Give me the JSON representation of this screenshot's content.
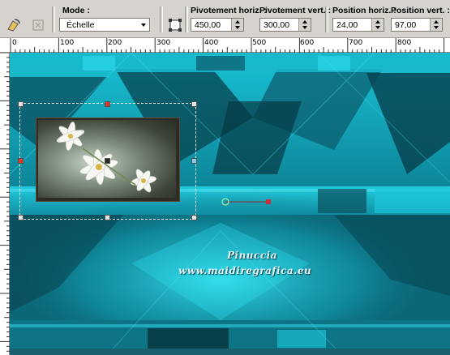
{
  "toolbar": {
    "mode_label": "Mode :",
    "mode_value": "Échelle",
    "pivot_h_label": "Pivotement horiz. :",
    "pivot_h_value": "450,00",
    "pivot_v_label": "Pivotement vert. :",
    "pivot_v_value": "300,00",
    "pos_h_label": "Position horiz. :",
    "pos_h_value": "24,00",
    "pos_v_label": "Position vert. :",
    "pos_v_value": "97,00"
  },
  "ruler": {
    "top_ticks": [
      "0",
      "100",
      "200",
      "300",
      "400",
      "500",
      "600",
      "700",
      "800"
    ]
  },
  "canvas": {
    "watermark_line1": "Pinuccia",
    "watermark_line2": "www.maidiregrafica.eu"
  },
  "colors": {
    "toolbar_bg": "#d6d3ce",
    "canvas_accent": "#19c6d8",
    "canvas_dark": "#07414e"
  }
}
